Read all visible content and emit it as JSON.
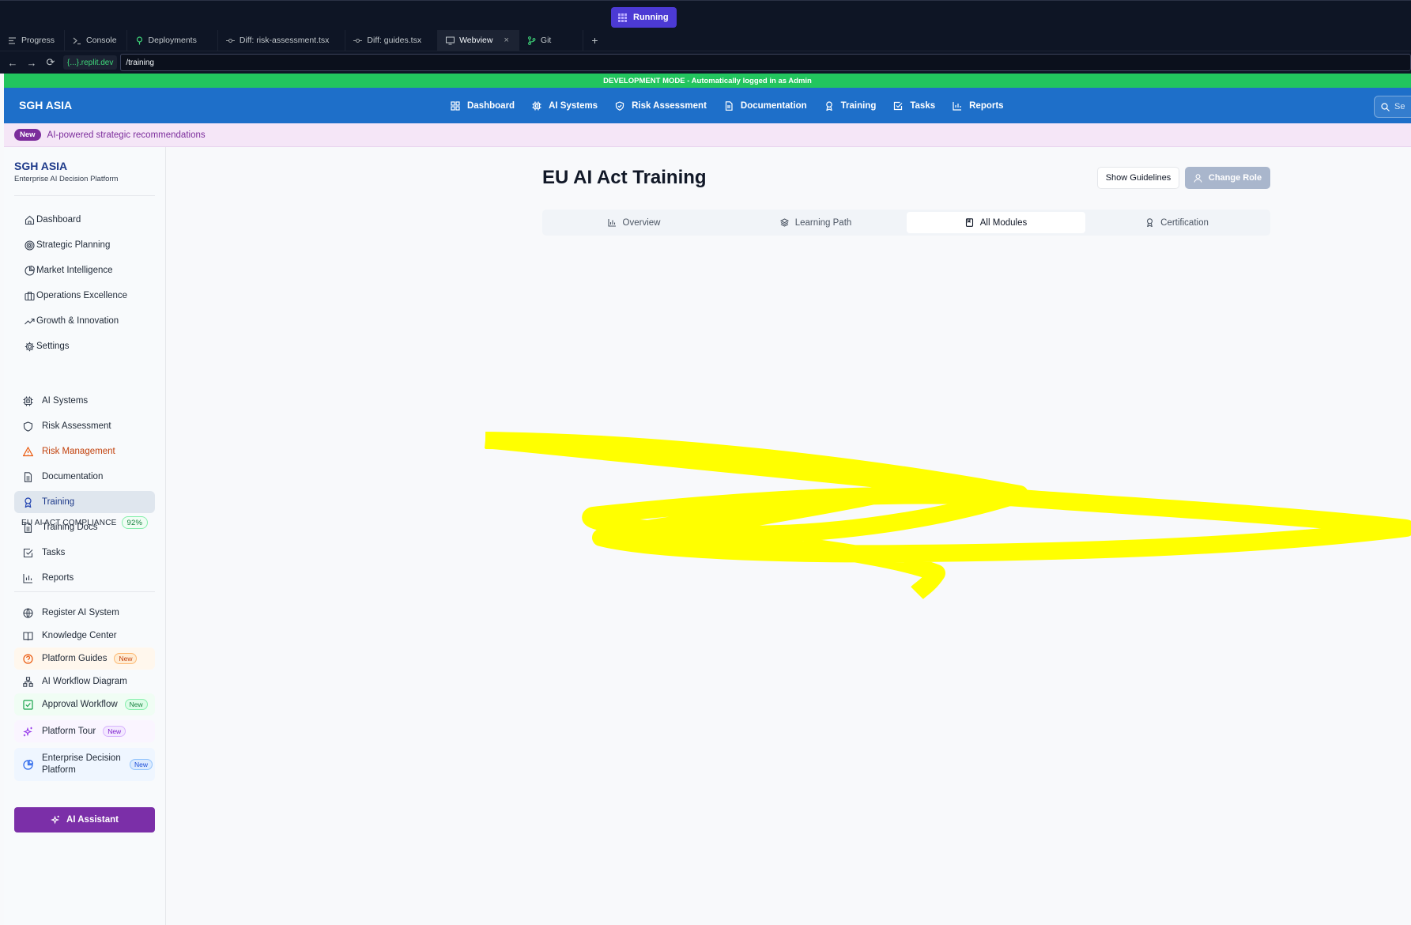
{
  "ide": {
    "run_status": "Running",
    "tabs": [
      {
        "label": "Progress",
        "icon": "progress-icon"
      },
      {
        "label": "Console",
        "icon": "terminal-icon"
      },
      {
        "label": "Deployments",
        "icon": "deploy-icon"
      },
      {
        "label": "Diff: risk-assessment.tsx",
        "icon": "git-commit-icon"
      },
      {
        "label": "Diff: guides.tsx",
        "icon": "git-commit-icon"
      },
      {
        "label": "Webview",
        "icon": "monitor-icon"
      },
      {
        "label": "Git",
        "icon": "git-branch-icon"
      }
    ],
    "domain": "{...}.replit.dev",
    "path": "/training"
  },
  "app": {
    "dev_banner": "DEVELOPMENT MODE - Automatically logged in as Admin",
    "brand": "SGH ASIA",
    "nav": [
      {
        "label": "Dashboard",
        "icon": "grid-icon"
      },
      {
        "label": "AI Systems",
        "icon": "cpu-icon"
      },
      {
        "label": "Risk Assessment",
        "icon": "shield-check-icon"
      },
      {
        "label": "Documentation",
        "icon": "document-icon"
      },
      {
        "label": "Training",
        "icon": "award-icon"
      },
      {
        "label": "Tasks",
        "icon": "checkbox-icon"
      },
      {
        "label": "Reports",
        "icon": "bar-chart-icon"
      }
    ],
    "search_placeholder": "Se",
    "promo_badge": "New",
    "promo_text": "AI-powered strategic recommendations"
  },
  "sidebar": {
    "brand": "SGH ASIA",
    "subtitle": "Enterprise AI Decision Platform",
    "primary": [
      {
        "label": "Dashboard",
        "icon": "home-icon"
      },
      {
        "label": "Strategic Planning",
        "icon": "target-icon"
      },
      {
        "label": "Market Intelligence",
        "icon": "pie-chart-icon"
      },
      {
        "label": "Operations Excellence",
        "icon": "briefcase-icon"
      },
      {
        "label": "Growth & Innovation",
        "icon": "trending-up-icon"
      },
      {
        "label": "Settings",
        "icon": "gear-icon"
      }
    ],
    "section_title": "EU AI ACT COMPLIANCE",
    "section_pct": "92%",
    "compliance": [
      {
        "label": "AI Systems",
        "icon": "cpu-icon"
      },
      {
        "label": "Risk Assessment",
        "icon": "shield-icon"
      },
      {
        "label": "Risk Management",
        "icon": "warning-icon"
      },
      {
        "label": "Documentation",
        "icon": "document-icon"
      },
      {
        "label": "Training",
        "icon": "award-icon"
      },
      {
        "label": "Training Docs",
        "icon": "document-icon"
      },
      {
        "label": "Tasks",
        "icon": "checkbox-icon"
      },
      {
        "label": "Reports",
        "icon": "bar-chart-icon"
      }
    ],
    "extra": [
      {
        "label": "Register AI System",
        "icon": "globe-icon"
      },
      {
        "label": "Knowledge Center",
        "icon": "book-icon"
      },
      {
        "label": "Platform Guides",
        "icon": "help-circle-icon",
        "badge": "New"
      },
      {
        "label": "AI Workflow Diagram",
        "icon": "workflow-icon"
      },
      {
        "label": "Approval Workflow",
        "icon": "check-square-icon",
        "badge": "New"
      },
      {
        "label": "Platform Tour",
        "icon": "sparkles-icon",
        "badge": "New"
      },
      {
        "label": "Enterprise Decision Platform",
        "icon": "pie-chart-icon",
        "badge": "New"
      }
    ],
    "ai_assistant": "AI Assistant"
  },
  "main": {
    "title": "EU AI Act Training",
    "show_guidelines": "Show Guidelines",
    "change_role": "Change Role",
    "tabs": [
      {
        "label": "Overview",
        "icon": "bar-chart-icon"
      },
      {
        "label": "Learning Path",
        "icon": "layers-icon"
      },
      {
        "label": "All Modules",
        "icon": "book-icon",
        "active": true
      },
      {
        "label": "Certification",
        "icon": "award-icon"
      }
    ]
  },
  "colors": {
    "ide_bg": "#0e1525",
    "run_button": "#4c3ad4",
    "dev_banner": "#22c55e",
    "header_blue": "#1e6fc9",
    "promo_bg": "#f5e6f7",
    "accent_purple": "#7b2fa8",
    "annotation_highlight": "#ffff00"
  }
}
